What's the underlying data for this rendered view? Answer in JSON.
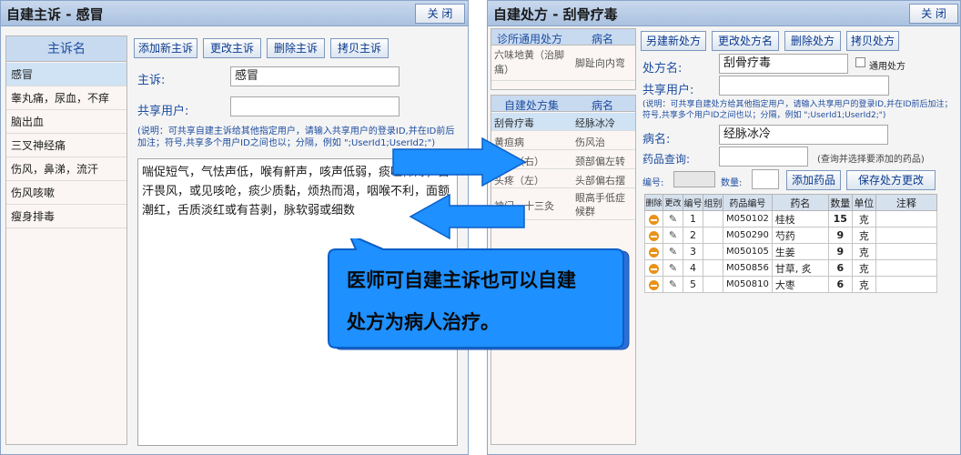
{
  "left_window": {
    "title": "自建主诉 - 感冒",
    "close_label": "关 闭",
    "list_header": "主诉名",
    "list_items": [
      "感冒",
      "睾丸痛，尿血，不痒",
      "脑出血",
      "三叉神经痛",
      "伤风，鼻涕，流汗",
      "伤风咳嗽",
      "瘦身排毒"
    ],
    "buttons": {
      "add": "添加新主诉",
      "edit": "更改主诉",
      "delete": "删除主诉",
      "copy": "拷贝主诉"
    },
    "complaint_label": "主诉:",
    "complaint_value": "感冒",
    "share_label": "共享用户:",
    "share_value": "",
    "note": "(说明：可共享自建主诉给其他指定用户，请输入共享用户的登录ID,并在ID前后加注；符号,共享多个用户ID之间也以；分隔，例如 \";UserId1;UserId2;\")",
    "description": "喘促短气，气怯声低，喉有鼾声，咳声低弱，痰吐稀薄，自汗畏风，或见咳呛，痰少质黏，烦热而渴，咽喉不利，面额潮红，舌质淡红或有苔剥，脉软弱或细数"
  },
  "right_window": {
    "title": "自建处方 - 刮骨疗毒",
    "close_label": "关 闭",
    "clinic_header": {
      "col1": "诊所通用处方",
      "col2": "病名"
    },
    "clinic_rows": [
      {
        "name": "六味地黄（治脚痛）",
        "disease": "脚趾向内弯"
      }
    ],
    "own_header": {
      "col1": "自建处方集",
      "col2": "病名"
    },
    "own_rows": [
      {
        "name": "刮骨疗毒",
        "disease": "经脉冰冷"
      },
      {
        "name": "黄疸病",
        "disease": "伤风治"
      },
      {
        "name": "颈疼（右）",
        "disease": "颈部偏左转"
      },
      {
        "name": "头疼（左）",
        "disease": "头部偏右摆"
      },
      {
        "name": "神门一十三灸",
        "disease": "眼高手低症候群"
      }
    ],
    "buttons": {
      "save_new": "另建新处方",
      "rename": "更改处方名",
      "delete": "删除处方",
      "copy": "拷贝处方"
    },
    "rx_name_label": "处方名:",
    "rx_name_value": "刮骨疗毒",
    "general_label": "通用处方",
    "share_label": "共享用户:",
    "share_value": "",
    "note": "(说明：可共享自建处方给其他指定用户，请输入共享用户的登录ID,并在ID前后加注；符号,共享多个用户ID之间也以；分隔，例如 \";UserId1;UserId2;\")",
    "disease_label": "病名:",
    "disease_value": "经脉冰冷",
    "search_label": "药品查询:",
    "search_value": "",
    "search_hint": "(查询并选择要添加的药品)",
    "code_label": "编号:",
    "qty_label": "数量:",
    "add_drug": "添加药品",
    "save_changes": "保存处方更改",
    "table_headers": [
      "删除",
      "更改",
      "编号",
      "组别",
      "药品编号",
      "药名",
      "数量",
      "单位",
      "注释"
    ],
    "table_rows": [
      {
        "no": "1",
        "group": "",
        "code": "M050102",
        "name": "桂枝",
        "qty": "15",
        "unit": "克",
        "note": ""
      },
      {
        "no": "2",
        "group": "",
        "code": "M050290",
        "name": "芍药",
        "qty": "9",
        "unit": "克",
        "note": ""
      },
      {
        "no": "3",
        "group": "",
        "code": "M050105",
        "name": "生姜",
        "qty": "9",
        "unit": "克",
        "note": ""
      },
      {
        "no": "4",
        "group": "",
        "code": "M050856",
        "name": "甘草, 炙",
        "qty": "6",
        "unit": "克",
        "note": ""
      },
      {
        "no": "5",
        "group": "",
        "code": "M050810",
        "name": "大枣",
        "qty": "6",
        "unit": "克",
        "note": ""
      }
    ]
  },
  "callout": {
    "line1": "医师可自建主诉也可以自建",
    "line2": "处方为病人治疗。"
  },
  "colors": {
    "arrow": "#1e90ff",
    "callout": "#1e90ff",
    "accent": "#1f4ea0"
  }
}
